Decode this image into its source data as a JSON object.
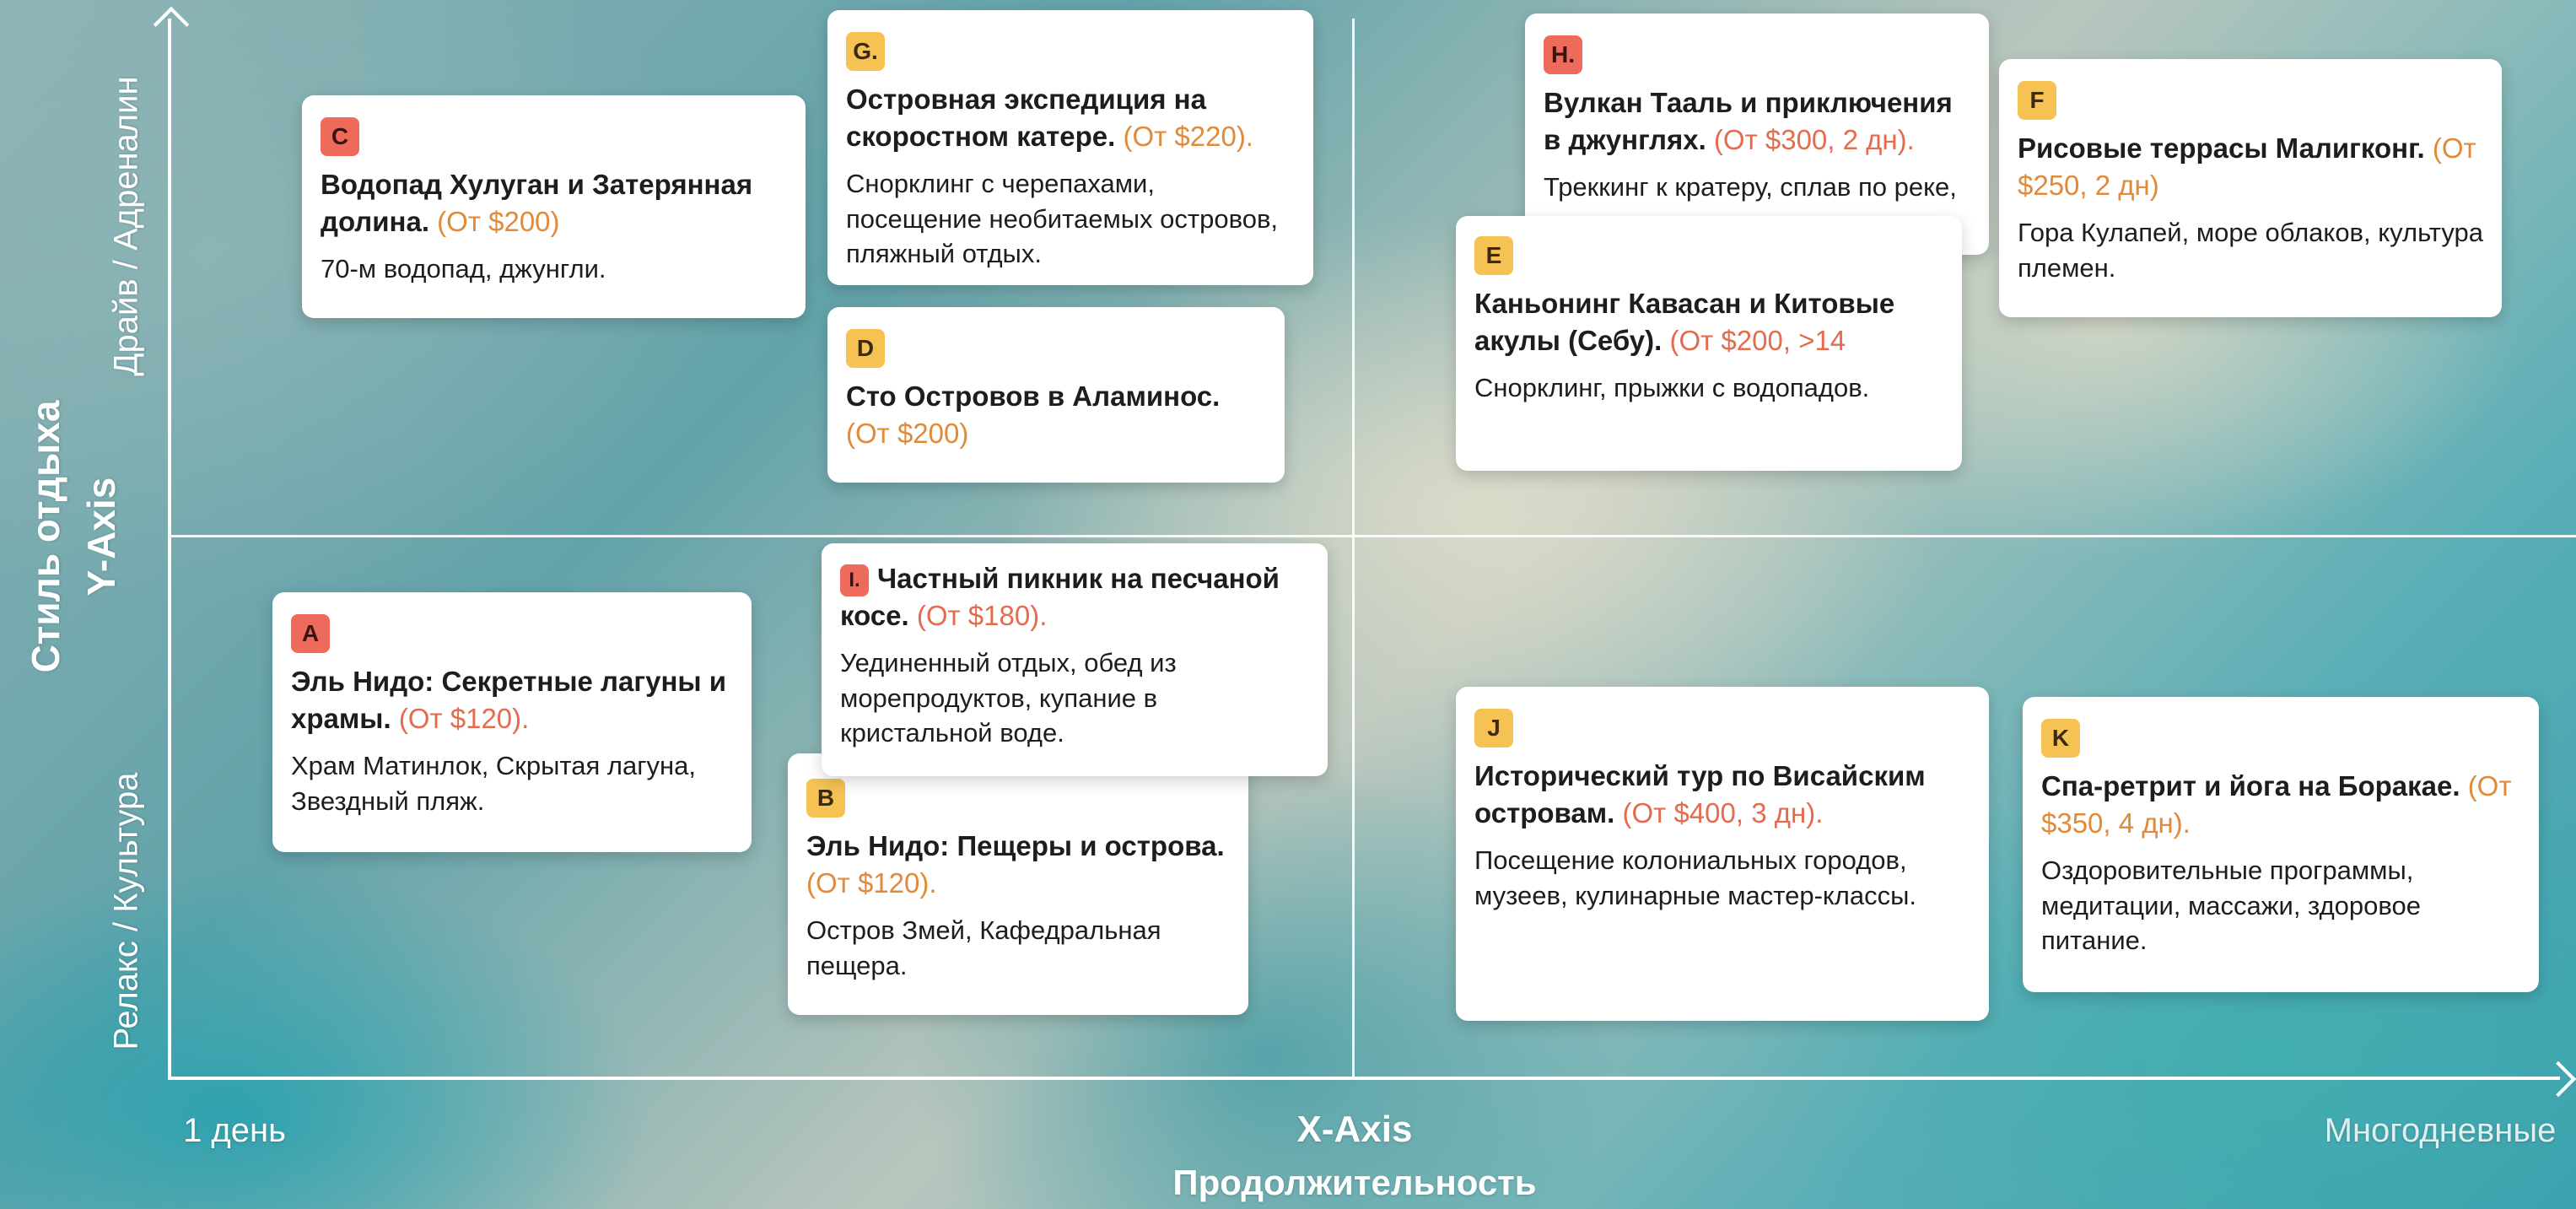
{
  "axes": {
    "y_title": "Стиль отдыха",
    "y_axis_name": "Y-Axis",
    "y_top": "Драйв / Адреналин",
    "y_bottom": "Релакс / Культура",
    "x_left": "1 день",
    "x_axis_name": "X-Axis",
    "x_right": "Многодневные",
    "x_title": "Продолжительность"
  },
  "cards": {
    "c": {
      "badge": "C",
      "title": "Водопад Хулуган и Затерянная долина.",
      "price": "(От $200)",
      "desc": "70-м водопад, джунгли."
    },
    "g": {
      "badge": "G.",
      "title": "Островная экспедиция на скоростном катере.",
      "price": "(От $220).",
      "desc": "Снорклинг с черепахами, посещение необитаемых островов, пляжный отдых."
    },
    "d": {
      "badge": "D",
      "title": "Сто Островов в Аламинос.",
      "price": "(От $200)",
      "desc": ""
    },
    "h": {
      "badge": "H.",
      "title": "Вулкан Тааль и приключения в джунглях.",
      "price": "(От $300, 2 дн).",
      "desc": "Треккинг к кратеру, сплав по реке, ночевка в эко-лодже."
    },
    "e": {
      "badge": "E",
      "title": "Каньонинг Кавасан и Китовые акулы (Себу).",
      "price": "(От $200, >14",
      "desc": "Снорклинг, прыжки с водопадов."
    },
    "f": {
      "badge": "F",
      "title": "Рисовые террасы Малигконг.",
      "price": "(От $250, 2 дн)",
      "desc": "Гора Кулапей, море облаков, культура племен."
    },
    "a": {
      "badge": "A",
      "title": "Эль Нидо: Секретные лагуны и храмы.",
      "price": "(От $120).",
      "desc": "Храм Матинлок, Скрытая лагуна, Звездный пляж."
    },
    "i": {
      "badge": "I.",
      "title": "Частный пикник на песчаной косе.",
      "price": "(От $180).",
      "desc": "Уединенный отдых, обед из морепродуктов, купание в кристальной воде."
    },
    "b": {
      "badge": "B",
      "title": "Эль Нидо: Пещеры и острова.",
      "price": "(От $120).",
      "desc": "Остров Змей, Кафедральная пещера."
    },
    "j": {
      "badge": "J",
      "title": "Исторический тур по Висайским островам.",
      "price": "(От $400, 3 дн).",
      "desc": "Посещение колониальных городов, музеев, кулинарные мастер-классы."
    },
    "k": {
      "badge": "K",
      "title": "Спа-ретрит и йога на Боракае.",
      "price": "(От $350, 4 дн).",
      "desc": "Оздоровительные программы, медитации, массажи, здоровое питание."
    }
  },
  "colors": {
    "badge_red": "#ee6a5a",
    "badge_yellow": "#f6c254",
    "price_orange": "#e08a3a",
    "axis": "#ffffff"
  }
}
